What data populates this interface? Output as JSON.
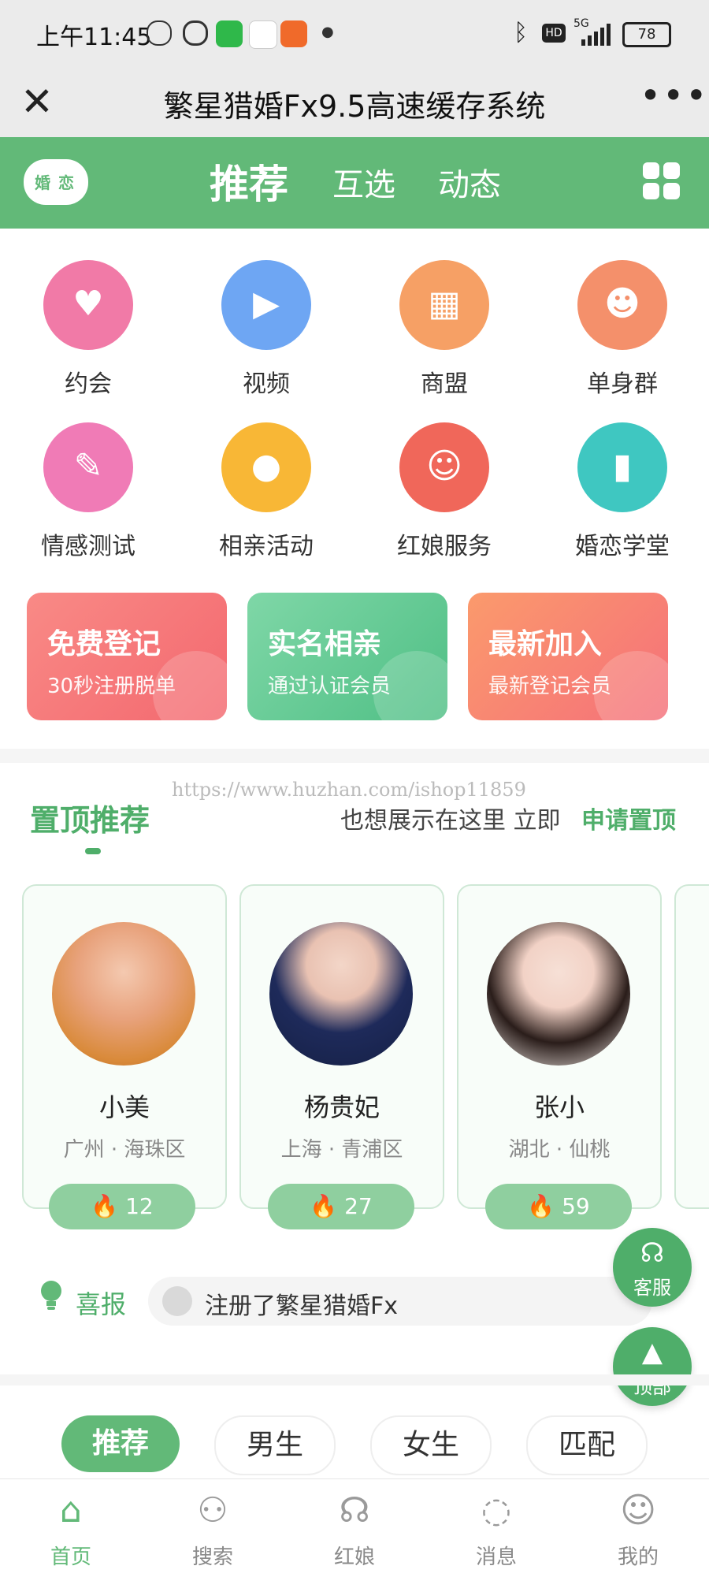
{
  "status_bar": {
    "time": "上午11:45",
    "battery": "78",
    "network": "5G",
    "hd": "HD"
  },
  "title_bar": {
    "title": "繁星猎婚Fx9.5高速缓存系统",
    "more": "•••",
    "close": "✕"
  },
  "header": {
    "logo_text": [
      "婚",
      "恋"
    ],
    "tabs": [
      {
        "label": "推荐",
        "active": true
      },
      {
        "label": "互选",
        "active": false
      },
      {
        "label": "动态",
        "active": false
      }
    ]
  },
  "categories": [
    {
      "label": "约会",
      "icon": "couple-icon",
      "color": "#f17aa7"
    },
    {
      "label": "视频",
      "icon": "video-icon",
      "color": "#6ea6f3"
    },
    {
      "label": "商盟",
      "icon": "store-icon",
      "color": "#f6a065"
    },
    {
      "label": "单身群",
      "icon": "group-icon",
      "color": "#f4906b"
    },
    {
      "label": "情感测试",
      "icon": "test-icon",
      "color": "#f07bb6"
    },
    {
      "label": "相亲活动",
      "icon": "balloon-icon",
      "color": "#f8b736"
    },
    {
      "label": "红娘服务",
      "icon": "matchmaker-icon",
      "color": "#f0675a"
    },
    {
      "label": "婚恋学堂",
      "icon": "book-icon",
      "color": "#3fc7c1"
    }
  ],
  "promos": [
    {
      "title": "免费登记",
      "subtitle": "30秒注册脱单",
      "color": "#f6787b"
    },
    {
      "title": "实名相亲",
      "subtitle": "通过认证会员",
      "color": "#64c995"
    },
    {
      "title": "最新加入",
      "subtitle": "最新登记会员",
      "color": "#f7836c"
    }
  ],
  "watermark": "https://www.huzhan.com/ishop11859",
  "featured": {
    "title": "置顶推荐",
    "cta_text": "也想展示在这里 立即",
    "cta_link": "申请置顶",
    "members": [
      {
        "name": "小美",
        "location": "广州 · 海珠区",
        "hot": "12"
      },
      {
        "name": "杨贵妃",
        "location": "上海 · 青浦区",
        "hot": "27"
      },
      {
        "name": "张小",
        "location": "湖北 · 仙桃",
        "hot": "59"
      }
    ]
  },
  "news": {
    "label": "喜报",
    "text": "注册了繁星猎婚Fx"
  },
  "fab": {
    "service": "客服",
    "top": "顶部"
  },
  "filter_tabs": [
    {
      "label": "推荐",
      "active": true
    },
    {
      "label": "男生",
      "active": false
    },
    {
      "label": "女生",
      "active": false
    },
    {
      "label": "匹配",
      "active": false
    }
  ],
  "bottom_nav": [
    {
      "label": "首页",
      "icon": "home-icon",
      "active": true
    },
    {
      "label": "搜索",
      "icon": "search-people-icon",
      "active": false
    },
    {
      "label": "红娘",
      "icon": "headset-icon",
      "active": false
    },
    {
      "label": "消息",
      "icon": "chat-icon",
      "active": false
    },
    {
      "label": "我的",
      "icon": "profile-icon",
      "active": false
    }
  ]
}
